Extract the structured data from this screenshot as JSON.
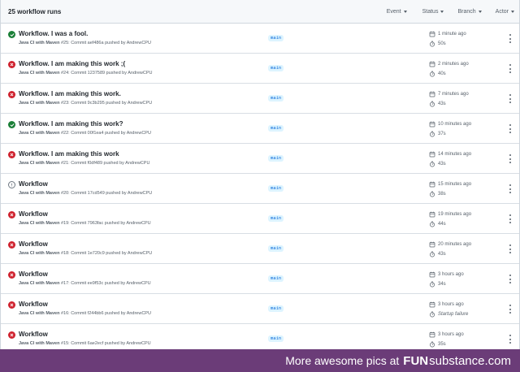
{
  "header": {
    "count_label": "25 workflow runs",
    "filters": [
      "Event",
      "Status",
      "Branch",
      "Actor"
    ]
  },
  "runs": [
    {
      "status": "success",
      "title": "Workflow. I was a fool.",
      "workflow": "Java CI with Maven",
      "meta": "#25: Commit aef486a pushed by AndrewCPU",
      "branch": "main",
      "time": "1 minute ago",
      "duration": "50s"
    },
    {
      "status": "failure",
      "title": "Workflow. I am making this work ;(",
      "workflow": "Java CI with Maven",
      "meta": "#24: Commit 1237589 pushed by AndrewCPU",
      "branch": "main",
      "time": "2 minutes ago",
      "duration": "40s"
    },
    {
      "status": "failure",
      "title": "Workflow. I am making this work.",
      "workflow": "Java CI with Maven",
      "meta": "#23: Commit 9c3b295 pushed by AndrewCPU",
      "branch": "main",
      "time": "7 minutes ago",
      "duration": "43s"
    },
    {
      "status": "success",
      "title": "Workflow. I am making this work?",
      "workflow": "Java CI with Maven",
      "meta": "#22: Commit 00f1ea4 pushed by AndrewCPU",
      "branch": "main",
      "time": "10 minutes ago",
      "duration": "37s"
    },
    {
      "status": "failure",
      "title": "Workflow. I am making this work",
      "workflow": "Java CI with Maven",
      "meta": "#21: Commit f0df489 pushed by AndrewCPU",
      "branch": "main",
      "time": "14 minutes ago",
      "duration": "43s"
    },
    {
      "status": "neutral",
      "title": "Workflow",
      "workflow": "Java CI with Maven",
      "meta": "#20: Commit 17cd549 pushed by AndrewCPU",
      "branch": "main",
      "time": "15 minutes ago",
      "duration": "38s"
    },
    {
      "status": "failure",
      "title": "Workflow",
      "workflow": "Java CI with Maven",
      "meta": "#19: Commit 7963fac pushed by AndrewCPU",
      "branch": "main",
      "time": "19 minutes ago",
      "duration": "44s"
    },
    {
      "status": "failure",
      "title": "Workflow",
      "workflow": "Java CI with Maven",
      "meta": "#18: Commit 1e720c9 pushed by AndrewCPU",
      "branch": "main",
      "time": "20 minutes ago",
      "duration": "43s"
    },
    {
      "status": "failure",
      "title": "Workflow",
      "workflow": "Java CI with Maven",
      "meta": "#17: Commit ee9f53c pushed by AndrewCPU",
      "branch": "main",
      "time": "3 hours ago",
      "duration": "34s"
    },
    {
      "status": "failure",
      "title": "Workflow",
      "workflow": "Java CI with Maven",
      "meta": "#16: Commit f244bb6 pushed by AndrewCPU",
      "branch": "main",
      "time": "3 hours ago",
      "duration": "Startup failure"
    },
    {
      "status": "failure",
      "title": "Workflow",
      "workflow": "Java CI with Maven",
      "meta": "#15: Commit 6ae2ecf pushed by AndrewCPU",
      "branch": "main",
      "time": "3 hours ago",
      "duration": "35s"
    }
  ],
  "icons": {
    "success": "check-circle-icon",
    "failure": "x-circle-icon",
    "neutral": "skipped-circle-icon",
    "time": "calendar-icon",
    "duration": "stopwatch-icon",
    "menu": "kebab-menu-icon"
  },
  "colors": {
    "success": "#1a7f37",
    "failure": "#cf222e",
    "branch_text": "#0969da",
    "branch_bg": "#ddf4ff",
    "banner_bg": "#6b3c78"
  },
  "banner": {
    "text": "More awesome pics at",
    "brand_bold": "FUN",
    "brand_rest": "substance.com"
  }
}
